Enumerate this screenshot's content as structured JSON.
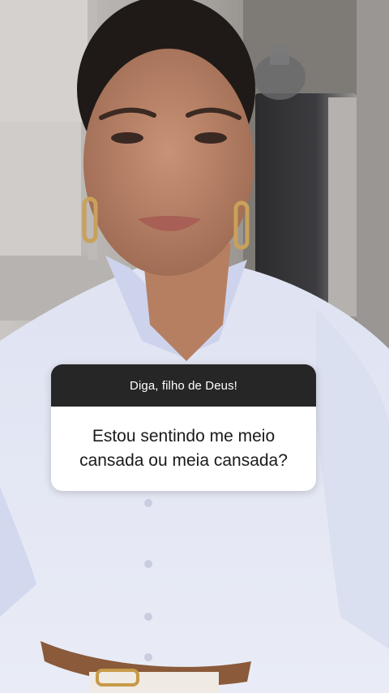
{
  "story": {
    "background_description_icon": "person-video-frame",
    "question_sticker": {
      "prompt": "Diga, filho de Deus!",
      "answer": "Estou sentindo me meio cansada ou meia cansada?",
      "header_color": "#262626",
      "body_color": "#ffffff"
    }
  }
}
